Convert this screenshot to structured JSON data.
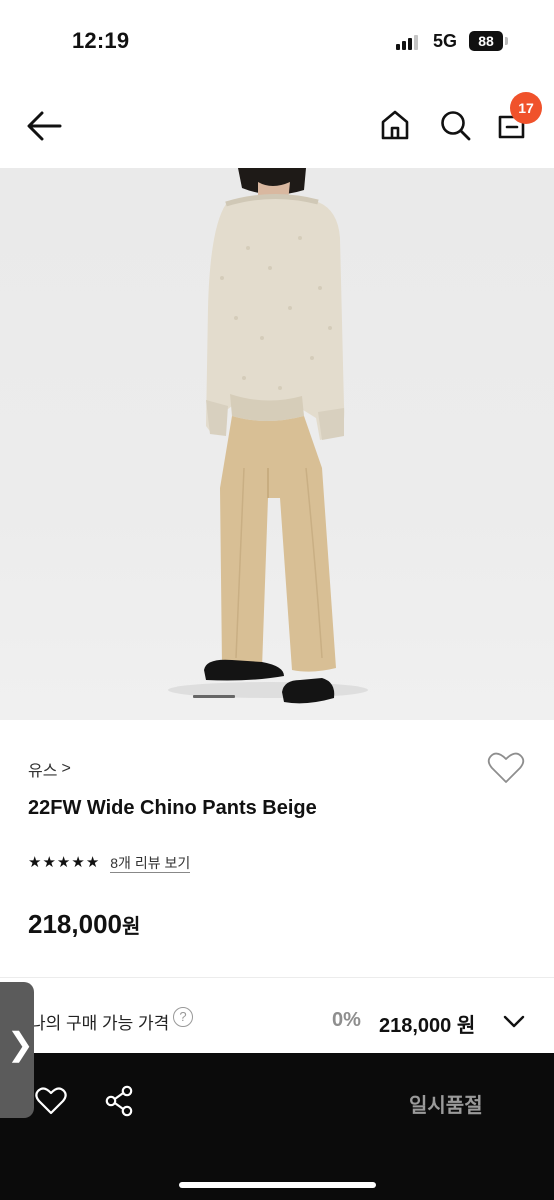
{
  "status_bar": {
    "time": "12:19",
    "network": "5G",
    "battery": "88",
    "signal_bars_active": 3,
    "signal_bars_total": 4
  },
  "nav": {
    "back_icon": "arrow-left-icon",
    "home_icon": "home-icon",
    "search_icon": "search-icon",
    "cart_icon": "shopping-bag-icon",
    "cart_badge": "17",
    "badge_color": "#f0522b"
  },
  "product": {
    "brand": "유스",
    "brand_chevron": ">",
    "name": "22FW Wide Chino Pants Beige",
    "stars": [
      "★",
      "★",
      "★",
      "★",
      "★"
    ],
    "rating_value": 5,
    "review_link": "8개 리뷰 보기",
    "price": "218,000",
    "price_unit": "원",
    "image_carousel_current": 1
  },
  "buy_price": {
    "label": "나의 구매 가능 가격",
    "help_icon": "?",
    "discount": "0%",
    "price": "218,000 원"
  },
  "action_bar": {
    "wishlist_icon": "heart-icon",
    "share_icon": "share-icon",
    "status_button": "일시품절"
  },
  "side_handle": {
    "glyph": "❯"
  },
  "colors": {
    "accent": "#f0522b",
    "action_bar_bg": "#0b0b0b",
    "muted_text": "#9a9a9a"
  }
}
